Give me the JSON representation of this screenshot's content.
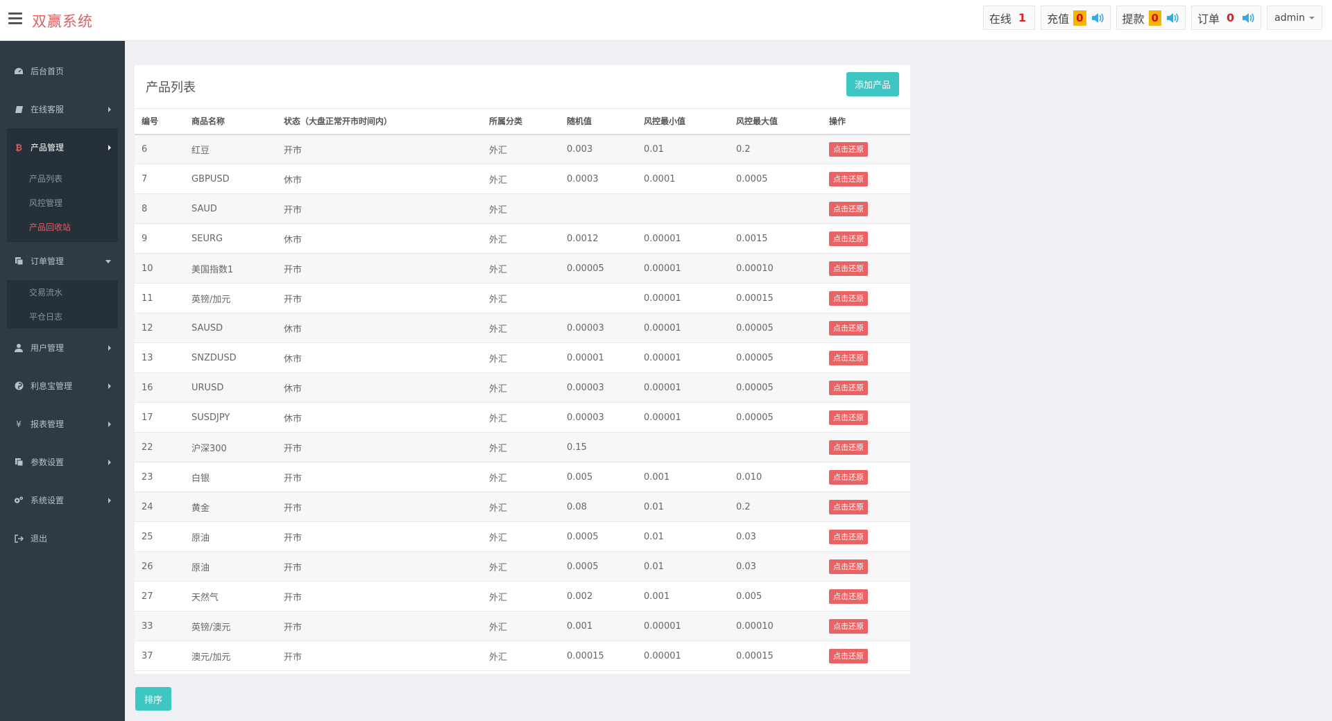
{
  "app": {
    "title": "双赢系统"
  },
  "topbar": {
    "online": {
      "label": "在线",
      "count": "1"
    },
    "recharge": {
      "label": "充值",
      "count": "0"
    },
    "withdraw": {
      "label": "提款",
      "count": "0"
    },
    "orders": {
      "label": "订单",
      "count": "0"
    },
    "user": "admin"
  },
  "sidebar": {
    "items": [
      {
        "label": "后台首页",
        "icon": "dashboard-icon"
      },
      {
        "label": "在线客服",
        "icon": "book-icon"
      },
      {
        "label": "产品管理",
        "icon": "bitcoin-icon",
        "active": true,
        "children": [
          "产品列表",
          "风控管理",
          "产品回收站"
        ],
        "active_child": "产品回收站"
      },
      {
        "label": "订单管理",
        "icon": "copy-icon",
        "open": true,
        "children": [
          "交易流水",
          "平仓日志"
        ]
      },
      {
        "label": "用户管理",
        "icon": "user-icon"
      },
      {
        "label": "利息宝管理",
        "icon": "pinterest-icon"
      },
      {
        "label": "报表管理",
        "icon": "yen-icon"
      },
      {
        "label": "参数设置",
        "icon": "copy-icon"
      },
      {
        "label": "系统设置",
        "icon": "cogs-icon"
      },
      {
        "label": "退出",
        "icon": "sign-out-icon"
      }
    ]
  },
  "panel": {
    "title": "产品列表",
    "add_button": "添加产品",
    "columns": [
      "编号",
      "商品名称",
      "状态（大盘正常开市时间内）",
      "所属分类",
      "随机值",
      "风控最小值",
      "风控最大值",
      "操作"
    ],
    "action_label": "点击还原",
    "rows": [
      [
        "6",
        "红豆",
        "开市",
        "外汇",
        "0.003",
        "0.01",
        "0.2"
      ],
      [
        "7",
        "GBPUSD",
        "休市",
        "外汇",
        "0.0003",
        "0.0001",
        "0.0005"
      ],
      [
        "8",
        "SAUD",
        "开市",
        "外汇",
        "",
        "",
        ""
      ],
      [
        "9",
        "SEURG",
        "休市",
        "外汇",
        "0.0012",
        "0.00001",
        "0.0015"
      ],
      [
        "10",
        "美国指数1",
        "开市",
        "外汇",
        "0.00005",
        "0.00001",
        "0.00010"
      ],
      [
        "11",
        "英镑/加元",
        "开市",
        "外汇",
        "",
        "0.00001",
        "0.00015"
      ],
      [
        "12",
        "SAUSD",
        "休市",
        "外汇",
        "0.00003",
        "0.00001",
        "0.00005"
      ],
      [
        "13",
        "SNZDUSD",
        "休市",
        "外汇",
        "0.00001",
        "0.00001",
        "0.00005"
      ],
      [
        "16",
        "URUSD",
        "休市",
        "外汇",
        "0.00003",
        "0.00001",
        "0.00005"
      ],
      [
        "17",
        "SUSDJPY",
        "休市",
        "外汇",
        "0.00003",
        "0.00001",
        "0.00005"
      ],
      [
        "22",
        "沪深300",
        "开市",
        "外汇",
        "0.15",
        "",
        ""
      ],
      [
        "23",
        "白银",
        "开市",
        "外汇",
        "0.005",
        "0.001",
        "0.010"
      ],
      [
        "24",
        "黄金",
        "开市",
        "外汇",
        "0.08",
        "0.01",
        "0.2"
      ],
      [
        "25",
        "原油",
        "开市",
        "外汇",
        "0.0005",
        "0.01",
        "0.03"
      ],
      [
        "26",
        "原油",
        "开市",
        "外汇",
        "0.0005",
        "0.01",
        "0.03"
      ],
      [
        "27",
        "天然气",
        "开市",
        "外汇",
        "0.002",
        "0.001",
        "0.005"
      ],
      [
        "33",
        "英镑/澳元",
        "开市",
        "外汇",
        "0.001",
        "0.00001",
        "0.00010"
      ],
      [
        "37",
        "澳元/加元",
        "开市",
        "外汇",
        "0.00015",
        "0.00001",
        "0.00015"
      ]
    ],
    "sort_button": "排序"
  },
  "colors": {
    "brand": "#e06161",
    "accent": "#3ec6c3",
    "danger": "#e96364",
    "sidebar": "#2f3a47"
  }
}
